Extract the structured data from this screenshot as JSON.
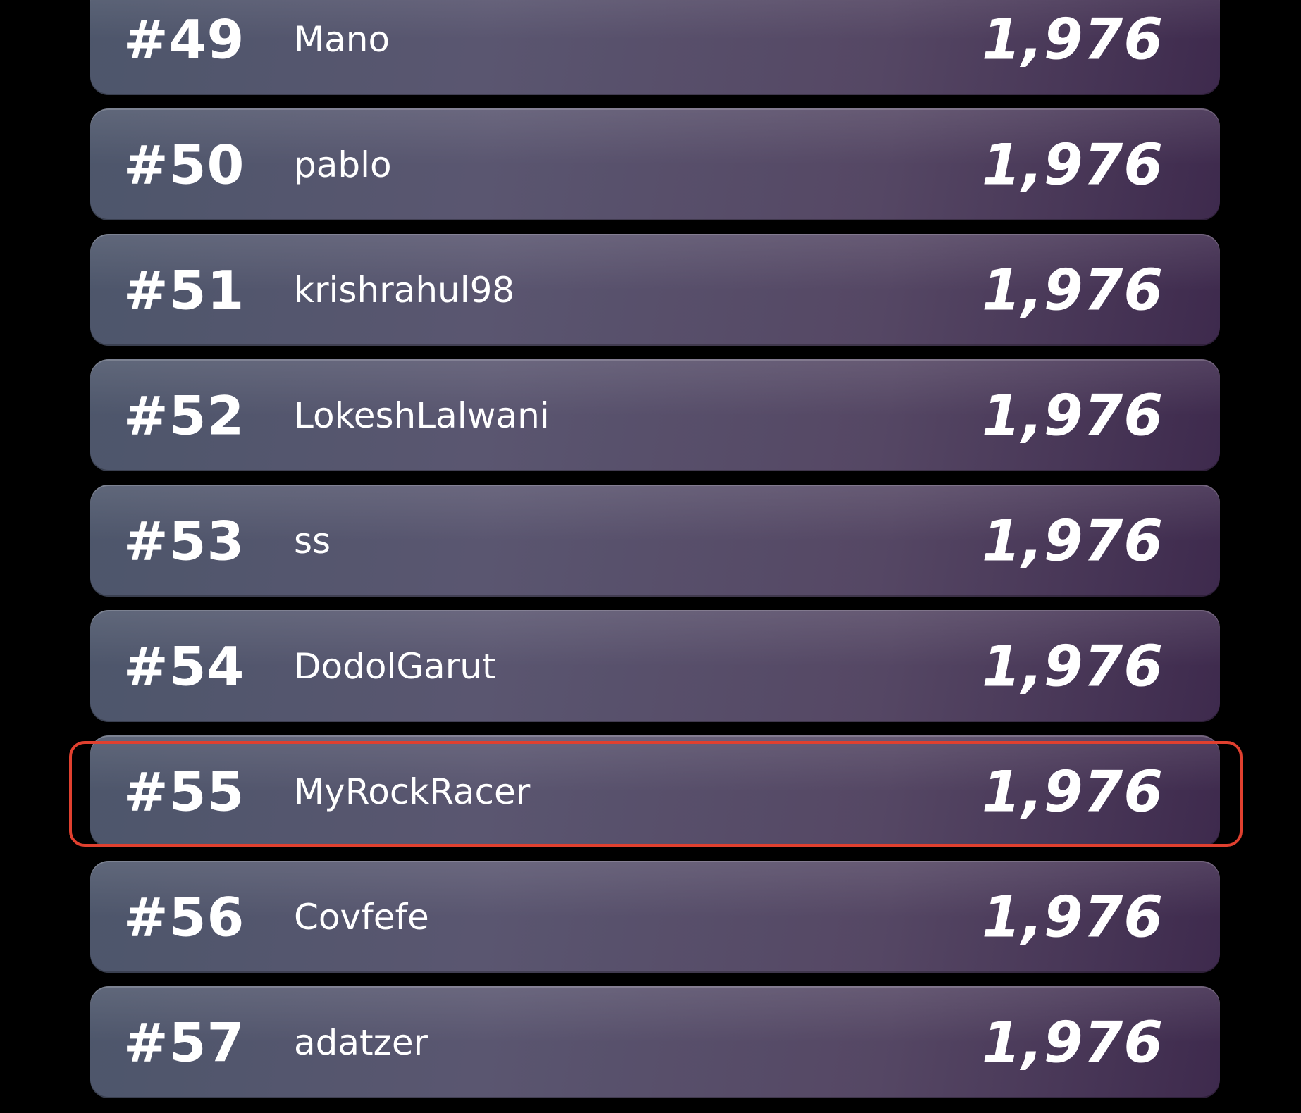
{
  "leaderboard": {
    "rows": [
      {
        "rank": "#49",
        "name": "Mano",
        "score": "1,976"
      },
      {
        "rank": "#50",
        "name": "pablo",
        "score": "1,976"
      },
      {
        "rank": "#51",
        "name": "krishrahul98",
        "score": "1,976"
      },
      {
        "rank": "#52",
        "name": "LokeshLalwani",
        "score": "1,976"
      },
      {
        "rank": "#53",
        "name": "ss",
        "score": "1,976"
      },
      {
        "rank": "#54",
        "name": "DodolGarut",
        "score": "1,976"
      },
      {
        "rank": "#55",
        "name": "MyRockRacer",
        "score": "1,976",
        "highlighted": true
      },
      {
        "rank": "#56",
        "name": "Covfefe",
        "score": "1,976"
      },
      {
        "rank": "#57",
        "name": "adatzer",
        "score": "1,976"
      }
    ],
    "highlight_color": "#e0402f"
  }
}
